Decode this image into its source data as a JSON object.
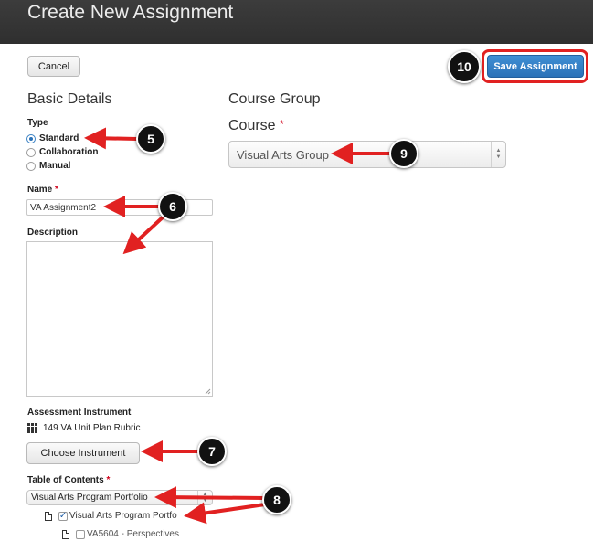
{
  "header": {
    "title": "Create New Assignment"
  },
  "toolbar": {
    "cancel_label": "Cancel",
    "save_label": "Save Assignment"
  },
  "basic_details": {
    "heading": "Basic Details",
    "type_label": "Type",
    "type_options": [
      {
        "label": "Standard",
        "selected": true
      },
      {
        "label": "Collaboration",
        "selected": false
      },
      {
        "label": "Manual",
        "selected": false
      }
    ],
    "name_label": "Name",
    "name_value": "VA Assignment2",
    "description_label": "Description",
    "description_value": "",
    "assessment_label": "Assessment Instrument",
    "assessment_value": "149 VA Unit Plan Rubric",
    "choose_instrument_label": "Choose Instrument",
    "toc_label": "Table of Contents",
    "toc_selected": "Visual Arts Program Portfolio",
    "tree": [
      {
        "label": "Visual Arts Program Portfo",
        "checked": true
      },
      {
        "label": "VA5604 - Perspectives",
        "checked": false
      }
    ]
  },
  "course_group": {
    "heading": "Course Group",
    "course_label": "Course",
    "course_selected": "Visual Arts Group"
  },
  "required_marker": "*",
  "callouts": [
    "5",
    "6",
    "7",
    "8",
    "9",
    "10"
  ],
  "colors": {
    "accent": "#2b72b8",
    "annotation": "#e12121",
    "header_bg": "#333333"
  }
}
